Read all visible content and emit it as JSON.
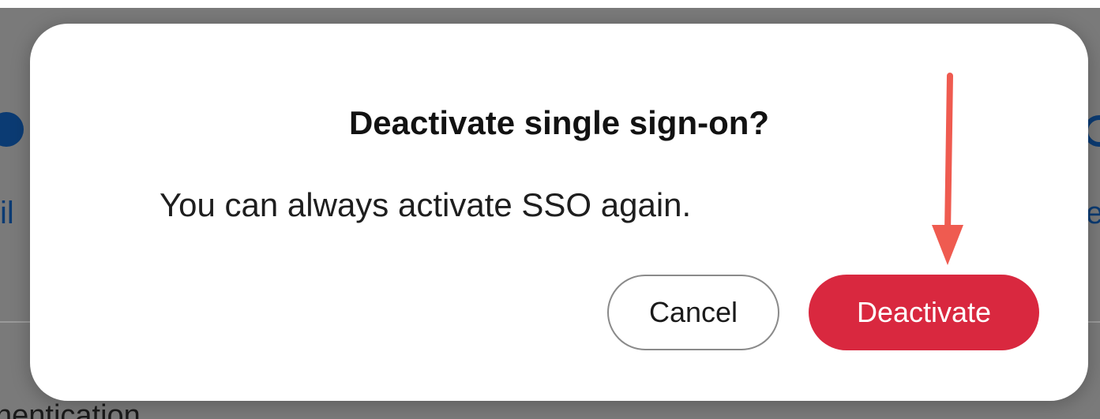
{
  "background": {
    "left_label": "il",
    "right_label": "e",
    "bottom_text": "hentication"
  },
  "dialog": {
    "title": "Deactivate single sign-on?",
    "message": "You can always activate SSO again.",
    "cancel_label": "Cancel",
    "confirm_label": "Deactivate"
  },
  "colors": {
    "confirm_button": "#d9283f",
    "annotation_arrow": "#ef5b50",
    "background_accent": "#0b3b73"
  }
}
